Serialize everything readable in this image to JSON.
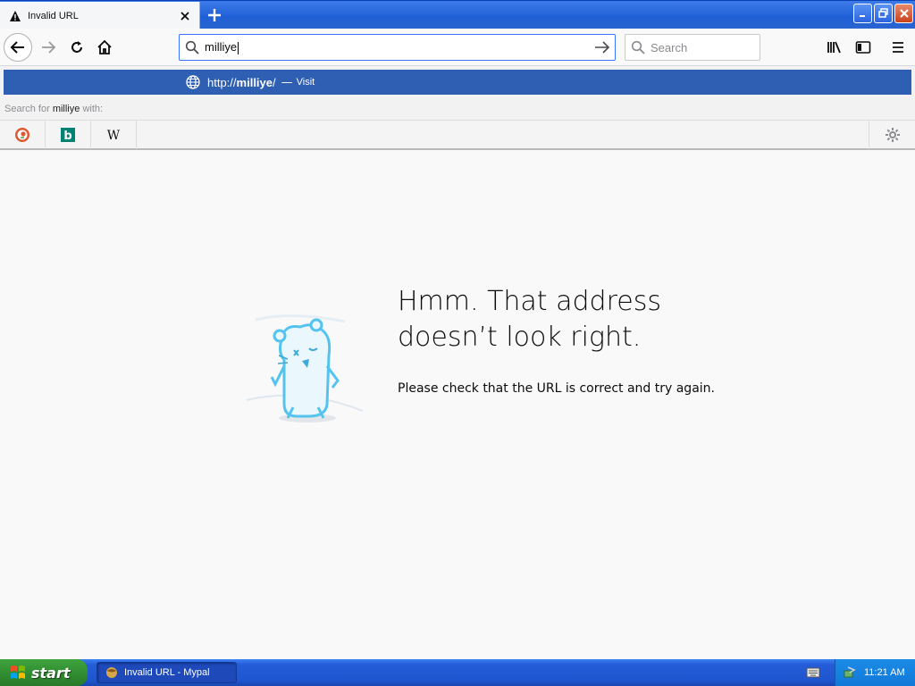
{
  "tab": {
    "title": "Invalid URL",
    "icon": "warning-icon"
  },
  "urlbar": {
    "value": "milliye"
  },
  "searchbar": {
    "placeholder": "Search"
  },
  "popup": {
    "result_url_prefix": "http://",
    "result_url_host": "milliye",
    "result_url_suffix": "/",
    "result_sep": "—",
    "result_action": "Visit",
    "search_for_prefix": "Search for",
    "search_term": "milliye",
    "search_for_suffix": "with:",
    "engines": [
      {
        "name": "duckduckgo-icon"
      },
      {
        "name": "bing-icon",
        "label": "b"
      },
      {
        "name": "wikipedia-icon",
        "label": "W"
      }
    ]
  },
  "page": {
    "title_line1": "Hmm. That address",
    "title_line2": "doesn’t look right.",
    "description": "Please check that the URL is correct and try again."
  },
  "taskbar": {
    "start_label": "start",
    "task_label": "Invalid URL - Mypal",
    "clock": "11:21 AM"
  },
  "colors": {
    "accent": "#3874ff",
    "highlight": "#2f5fb3",
    "xp_blue": "#245dd8",
    "xp_green": "#3fa33f"
  }
}
